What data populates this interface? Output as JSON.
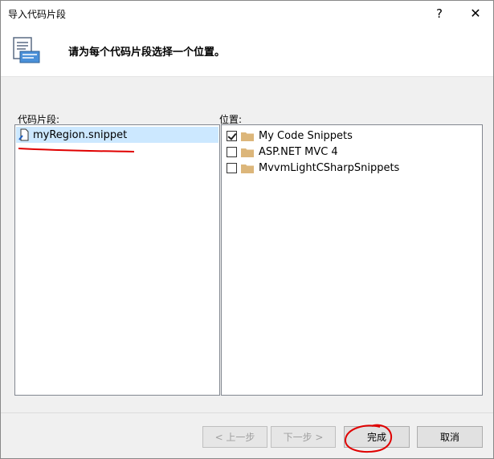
{
  "window": {
    "title": "导入代码片段",
    "help_label": "?",
    "close_label": "✕"
  },
  "header": {
    "instruction": "请为每个代码片段选择一个位置。"
  },
  "snippets": {
    "label": "代码片段:",
    "items": [
      {
        "name": "myRegion.snippet",
        "selected": true
      }
    ]
  },
  "locations": {
    "label": "位置:",
    "items": [
      {
        "name": "My Code Snippets",
        "checked": true
      },
      {
        "name": "ASP.NET MVC 4",
        "checked": false
      },
      {
        "name": "MvvmLightCSharpSnippets",
        "checked": false
      }
    ]
  },
  "buttons": {
    "prev": "< 上一步",
    "next": "下一步 >",
    "finish": "完成",
    "cancel": "取消"
  },
  "colors": {
    "selection": "#cce8ff",
    "annotation_red": "#e00000",
    "folder": "#dcb67a"
  }
}
